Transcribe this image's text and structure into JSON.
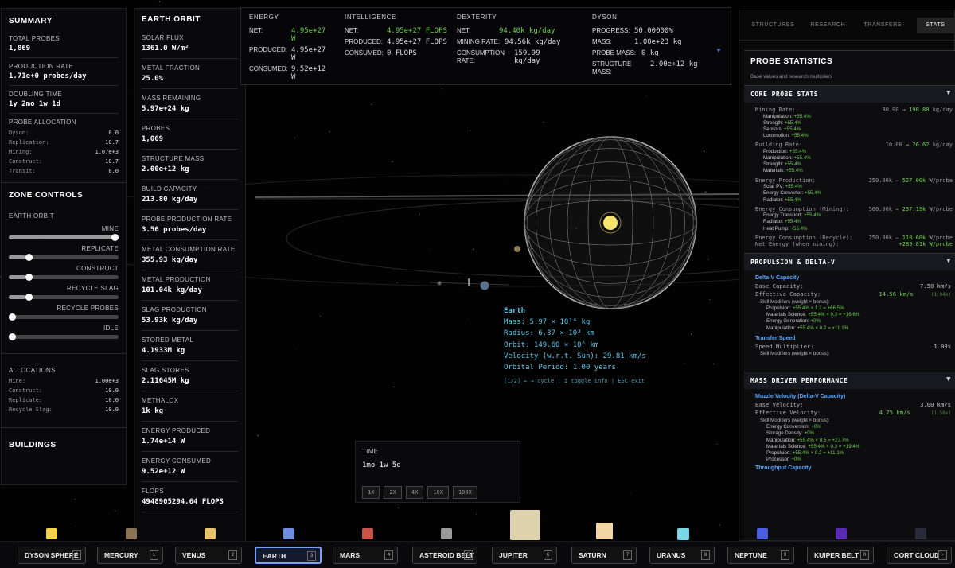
{
  "summary": {
    "title": "SUMMARY",
    "total_probes_label": "TOTAL PROBES",
    "total_probes": "1,069",
    "production_rate_label": "PRODUCTION RATE",
    "production_rate": "1.71e+0 probes/day",
    "doubling_label": "DOUBLING TIME",
    "doubling": "1y 2mo 1w 1d",
    "alloc_label": "PROBE ALLOCATION",
    "alloc": [
      {
        "k": "Dyson:",
        "v": "0.0"
      },
      {
        "k": "Replication:",
        "v": "10.7"
      },
      {
        "k": "Mining:",
        "v": "1.07e+3"
      },
      {
        "k": "Construct:",
        "v": "10.7"
      },
      {
        "k": "Transit:",
        "v": "0.0"
      }
    ]
  },
  "zone": {
    "title": "ZONE CONTROLS",
    "zone_name": "EARTH ORBIT",
    "sliders": [
      {
        "label": "MINE",
        "level": 1.0
      },
      {
        "label": "REPLICATE",
        "level": 0.15
      },
      {
        "label": "CONSTRUCT",
        "level": 0.15
      },
      {
        "label": "RECYCLE SLAG",
        "level": 0.15
      },
      {
        "label": "RECYCLE PROBES",
        "level": 0.0
      },
      {
        "label": "IDLE",
        "level": 0.0
      }
    ],
    "alloc_title": "ALLOCATIONS",
    "allocations": [
      {
        "k": "Mine:",
        "v": "1.00e+3"
      },
      {
        "k": "Construct:",
        "v": "10.0"
      },
      {
        "k": "Replicate:",
        "v": "10.0"
      },
      {
        "k": "Recycle Slag:",
        "v": "10.0"
      }
    ],
    "buildings_title": "BUILDINGS"
  },
  "orbit": {
    "title": "EARTH ORBIT",
    "stats": [
      {
        "k": "SOLAR FLUX",
        "v": "1361.0 W/m²"
      },
      {
        "k": "METAL FRACTION",
        "v": "25.0%"
      },
      {
        "k": "MASS REMAINING",
        "v": "5.97e+24 kg"
      },
      {
        "k": "PROBES",
        "v": "1,069"
      },
      {
        "k": "STRUCTURE MASS",
        "v": "2.00e+12 kg"
      },
      {
        "k": "BUILD CAPACITY",
        "v": "213.80 kg/day"
      },
      {
        "k": "PROBE PRODUCTION RATE",
        "v": "3.56 probes/day"
      },
      {
        "k": "METAL CONSUMPTION RATE",
        "v": "355.93 kg/day"
      },
      {
        "k": "METAL PRODUCTION",
        "v": "101.04k kg/day"
      },
      {
        "k": "SLAG PRODUCTION",
        "v": "53.93k kg/day"
      },
      {
        "k": "STORED METAL",
        "v": "4.1933M kg"
      },
      {
        "k": "SLAG STORES",
        "v": "2.11645M kg"
      },
      {
        "k": "METHALOX",
        "v": "1k kg"
      },
      {
        "k": "ENERGY PRODUCED",
        "v": "1.74e+14 W"
      },
      {
        "k": "ENERGY CONSUMED",
        "v": "9.52e+12 W"
      },
      {
        "k": "FLOPS",
        "v": "4948905294.64 FLOPS"
      }
    ]
  },
  "topbar": {
    "energy": {
      "h": "ENERGY",
      "net_k": "NET:",
      "net": "4.95e+27 W",
      "prod_k": "PRODUCED:",
      "prod": "4.95e+27 W",
      "cons_k": "CONSUMED:",
      "cons": "9.52e+12 W"
    },
    "intel": {
      "h": "INTELLIGENCE",
      "net_k": "NET:",
      "net": "4.95e+27 FLOPS",
      "prod_k": "PRODUCED:",
      "prod": "4.95e+27 FLOPS",
      "cons_k": "CONSUMED:",
      "cons": "0 FLOPS"
    },
    "dex": {
      "h": "DEXTERITY",
      "net_k": "NET:",
      "net": "94.40k kg/day",
      "mining_k": "MINING RATE:",
      "mining": "94.56k kg/day",
      "cons_k": "CONSUMPTION RATE:",
      "cons": "159.99 kg/day"
    },
    "dyson": {
      "h": "DYSON",
      "prog_k": "PROGRESS:",
      "prog": "50.00000%",
      "mass_k": "MASS:",
      "mass": "1.00e+23 kg",
      "pmass_k": "PROBE MASS:",
      "pmass": "0 kg",
      "smass_k": "STRUCTURE MASS:",
      "smass": "2.00e+12 kg"
    }
  },
  "tabs": [
    "STRUCTURES",
    "RESEARCH",
    "TRANSFERS",
    "STATS"
  ],
  "probe_stats": {
    "title": "PROBE STATISTICS",
    "subtitle": "Base values and research multipliers",
    "core_title": "CORE PROBE STATS",
    "mining": {
      "k": "Mining Rate:",
      "a": "80.00",
      "b": "190.80",
      "u": "kg/day",
      "mods": [
        [
          "Manipulation:",
          "+55.4%"
        ],
        [
          "Strength:",
          "+55.4%"
        ],
        [
          "Sensors:",
          "+55.4%"
        ],
        [
          "Locomotion:",
          "+55.4%"
        ]
      ]
    },
    "building": {
      "k": "Building Rate:",
      "a": "10.00",
      "b": "26.62",
      "u": "kg/day",
      "mods": [
        [
          "Production:",
          "+55.4%"
        ],
        [
          "Manipulation:",
          "+55.4%"
        ],
        [
          "Strength:",
          "+55.4%"
        ],
        [
          "Materials:",
          "+55.4%"
        ]
      ]
    },
    "eprod": {
      "k": "Energy Production:",
      "a": "250.00k",
      "b": "527.00k",
      "u": "W/probe",
      "mods": [
        [
          "Solar PV:",
          "+55.4%"
        ],
        [
          "Energy Converter:",
          "+55.4%"
        ],
        [
          "Radiator:",
          "+55.4%"
        ]
      ]
    },
    "emine": {
      "k": "Energy Consumption (Mining):",
      "a": "500.00k",
      "b": "237.19k",
      "u": "W/probe",
      "mods": [
        [
          "Energy Transport:",
          "+55.4%"
        ],
        [
          "Radiator:",
          "+55.4%"
        ],
        [
          "Heat Pump:",
          "+55.4%"
        ]
      ]
    },
    "erecycle": {
      "k": "Energy Consumption (Recycle):",
      "a": "250.00k",
      "b": "118.60k",
      "u": "W/probe"
    },
    "netenergy": {
      "k": "Net Energy (when mining):",
      "v": "+289.81k W/probe"
    },
    "prop_title": "PROPULSION & DELTA-V",
    "dv_cap": "Delta-V Capacity",
    "base_cap_k": "Base Capacity:",
    "base_cap": "7.50 km/s",
    "eff_cap_k": "Effective Capacity:",
    "eff_cap": "14.56 km/s",
    "eff_cap_x": "(1.94x)",
    "skill_mods": "Skill Modifiers (weight × bonus):",
    "prop_mods": [
      [
        "Propulsion:",
        "+55.4% × 1.2 = +66.5%"
      ],
      [
        "Materials Science:",
        "+55.4% × 0.3 = +16.6%"
      ],
      [
        "Energy Generation:",
        "+0%"
      ],
      [
        "Manipulation:",
        "+55.4% × 0.2 = +11.1%"
      ]
    ],
    "transfer": "Transfer Speed",
    "speed_k": "Speed Multiplier:",
    "speed": "1.00x",
    "md_title": "MASS DRIVER PERFORMANCE",
    "muzzle": "Muzzle Velocity (Delta-V Capacity)",
    "bv_k": "Base Velocity:",
    "bv": "3.00 km/s",
    "ev_k": "Effective Velocity:",
    "ev": "4.75 km/s",
    "ev_x": "(1.58x)",
    "md_mods": [
      [
        "Energy Conversion:",
        "+0%"
      ],
      [
        "Storage Density:",
        "+0%"
      ],
      [
        "Manipulation:",
        "+55.4% × 0.5 = +27.7%"
      ],
      [
        "Materials Science:",
        "+55.4% × 0.3 = +19.4%"
      ],
      [
        "Propulsion:",
        "+55.4% × 0.2 = +11.1%"
      ],
      [
        "Processor:",
        "+0%"
      ]
    ],
    "throughput": "Throughput Capacity"
  },
  "info": {
    "name": "Earth",
    "mass": "Mass: 5.97 × 10²⁴ kg",
    "radius": "Radius: 6.37 × 10³ km",
    "orbit": "Orbit: 149.60 × 10⁶ km",
    "velocity": "Velocity (w.r.t. Sun): 29.81 km/s",
    "period": "Orbital Period: 1.00 years",
    "hint": "[1/2] ← → cycle | I toggle info | ESC exit"
  },
  "time": {
    "label": "TIME",
    "value": "1mo 1w 5d",
    "speeds": [
      "1X",
      "2X",
      "4X",
      "10X",
      "100X"
    ]
  },
  "planets": [
    {
      "name": "DYSON SPHERE",
      "key": "0",
      "color": "#f5d04a"
    },
    {
      "name": "MERCURY",
      "key": "1",
      "color": "#8a7455"
    },
    {
      "name": "VENUS",
      "key": "2",
      "color": "#e9c26a"
    },
    {
      "name": "EARTH",
      "key": "3",
      "color": "#6d8ee0"
    },
    {
      "name": "MARS",
      "key": "4",
      "color": "#c8544a"
    },
    {
      "name": "ASTEROID BELT",
      "key": "5",
      "color": "#9a9a9a"
    },
    {
      "name": "JUPITER",
      "key": "6",
      "color": "#dfd3ad"
    },
    {
      "name": "SATURN",
      "key": "7",
      "color": "#f2d5a4"
    },
    {
      "name": "URANUS",
      "key": "8",
      "color": "#78d6e8"
    },
    {
      "name": "NEPTUNE",
      "key": "9",
      "color": "#4a5ee0"
    },
    {
      "name": "KUIPER BELT",
      "key": "0",
      "color": "#5a2ab0"
    },
    {
      "name": "OORT CLOUD",
      "key": "-",
      "color": "#2a2a3a"
    }
  ],
  "colors": {
    "accent_green": "#6dcf4f",
    "info_cyan": "#5ec8e8",
    "selected": "#7aa0ff"
  }
}
